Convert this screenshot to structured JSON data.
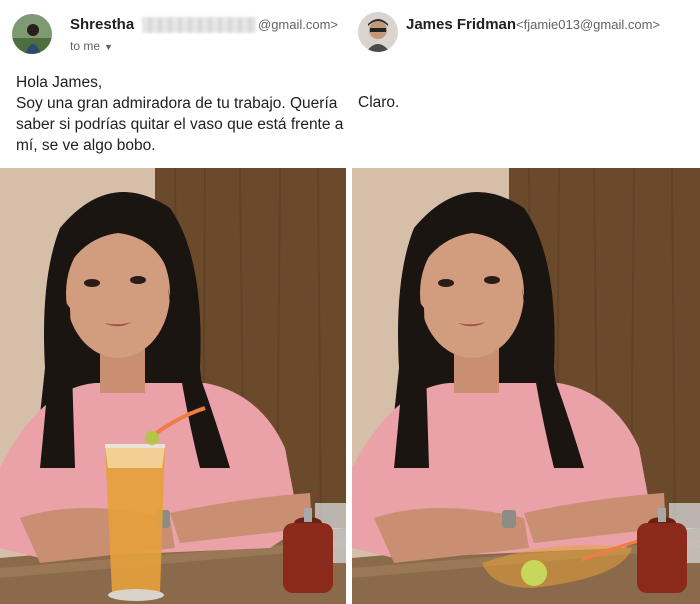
{
  "left_email": {
    "sender_name": "Shrestha",
    "sender_domain": "@gmail.com>",
    "recipient_label": "to me",
    "message": "Hola James,\nSoy una gran admiradora de tu trabajo.  Quería saber si podrías quitar el vaso que está frente a mí, se ve algo bobo."
  },
  "right_email": {
    "sender_name": "James Fridman",
    "sender_email": "<fjamie013@gmail.com>",
    "message": "Claro."
  },
  "colors": {
    "name_text": "#202124",
    "meta_text": "#5f6368",
    "shirt": "#eaa1a8",
    "juice": "#e6a13a",
    "wood": "#6b4a2c"
  },
  "icons": [
    "chevron-down-icon"
  ]
}
